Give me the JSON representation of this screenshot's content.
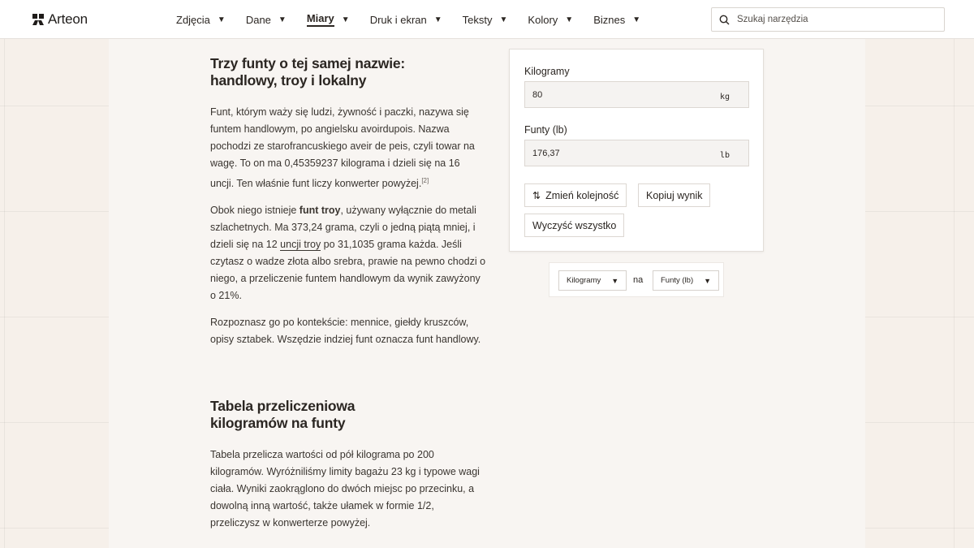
{
  "brand": {
    "name": "Arteon"
  },
  "nav": {
    "items": [
      {
        "label": "Zdjęcia",
        "active": false
      },
      {
        "label": "Dane",
        "active": false
      },
      {
        "label": "Miary",
        "active": true
      },
      {
        "label": "Druk i ekran",
        "active": false
      },
      {
        "label": "Teksty",
        "active": false
      },
      {
        "label": "Kolory",
        "active": false
      },
      {
        "label": "Biznes",
        "active": false
      }
    ],
    "caret": "▼"
  },
  "search": {
    "placeholder": "Szukaj narzędzia",
    "icon": "search-icon"
  },
  "article": {
    "heading1_line1": "Trzy funty o tej samej nazwie:",
    "heading1_line2": "handlowy, troy i lokalny",
    "p1": "Funt, którym waży się ludzi, żywność i paczki, nazywa się funtem handlowym, po angielsku avoirdupois. Nazwa pochodzi ze starofrancuskiego aveir de peis, czyli towar na wagę. To on ma 0,45359237 kilograma i dzieli się na 16 uncji. Ten właśnie funt liczy konwerter powyżej.",
    "p1_ref": "[2]",
    "p2_a": "Obok niego istnieje ",
    "p2_bold": "funt troy",
    "p2_b": ", używany wyłącznie do metali szlachetnych. Ma 373,24 grama, czyli o jedną piątą mniej, i dzieli się na 12 ",
    "p2_link": "uncji troy",
    "p2_c": " po 31,1035 grama każda. Jeśli czytasz o wadze złota albo srebra, prawie na pewno chodzi o niego, a przeliczenie funtem handlowym da wynik zawyżony o 21%.",
    "p3": "Rozpoznasz go po kontekście: mennice, giełdy kruszców, opisy sztabek. Wszędzie indziej funt oznacza funt handlowy.",
    "heading2_line1": "Tabela przeliczeniowa",
    "heading2_line2": "kilogramów na funty",
    "p4": "Tabela przelicza wartości od pół kilograma po 200 kilogramów. Wyróżniliśmy limity bagażu 23 kg i typowe wagi ciała. Wyniki zaokrąglono do dwóch miejsc po przecinku, a dowolną inną wartość, także ułamek w formie 1/2, przeliczysz w konwerterze powyżej."
  },
  "converter": {
    "from_label": "Kilogramy",
    "from_value": "80",
    "from_unit": "kg",
    "to_label": "Funty (lb)",
    "to_value": "176,37",
    "to_unit": "lb",
    "swap_icon": "⇅",
    "swap_label": "Zmień kolejność",
    "copy_label": "Kopiuj wynik",
    "clear_label": "Wyczyść wszystko"
  },
  "unit_selector": {
    "from": "Kilogramy",
    "connector": "na",
    "to": "Funty (lb)",
    "caret": "▼"
  },
  "colors": {
    "background": "#f6f0ea",
    "text": "#2b2622",
    "header": "#ffffff"
  }
}
